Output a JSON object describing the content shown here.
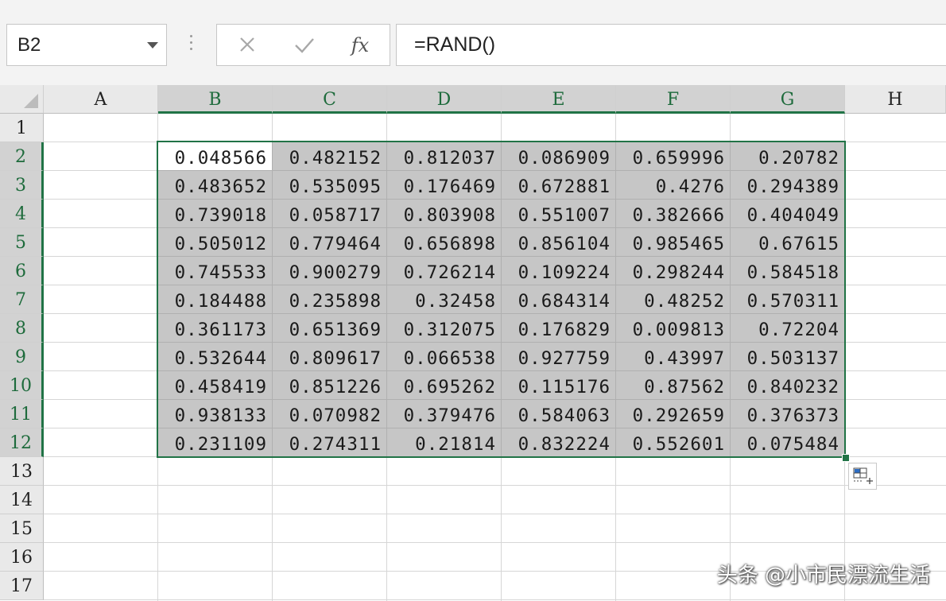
{
  "formula_bar": {
    "name_box": "B2",
    "fx_label": "fx",
    "formula": "=RAND()"
  },
  "columns": [
    "A",
    "B",
    "C",
    "D",
    "E",
    "F",
    "G",
    "H"
  ],
  "rows": [
    "1",
    "2",
    "3",
    "4",
    "5",
    "6",
    "7",
    "8",
    "9",
    "10",
    "11",
    "12",
    "13",
    "14",
    "15",
    "16",
    "17"
  ],
  "selection": {
    "active_cell": "B2",
    "range": "B2:G12",
    "accent_color": "#217346"
  },
  "data_table": [
    [
      "0.048566",
      "0.482152",
      "0.812037",
      "0.086909",
      "0.659996",
      "0.20782"
    ],
    [
      "0.483652",
      "0.535095",
      "0.176469",
      "0.672881",
      "0.4276",
      "0.294389"
    ],
    [
      "0.739018",
      "0.058717",
      "0.803908",
      "0.551007",
      "0.382666",
      "0.404049"
    ],
    [
      "0.505012",
      "0.779464",
      "0.656898",
      "0.856104",
      "0.985465",
      "0.67615"
    ],
    [
      "0.745533",
      "0.900279",
      "0.726214",
      "0.109224",
      "0.298244",
      "0.584518"
    ],
    [
      "0.184488",
      "0.235898",
      "0.32458",
      "0.684314",
      "0.48252",
      "0.570311"
    ],
    [
      "0.361173",
      "0.651369",
      "0.312075",
      "0.176829",
      "0.009813",
      "0.72204"
    ],
    [
      "0.532644",
      "0.809617",
      "0.066538",
      "0.927759",
      "0.43997",
      "0.503137"
    ],
    [
      "0.458419",
      "0.851226",
      "0.695262",
      "0.115176",
      "0.87562",
      "0.840232"
    ],
    [
      "0.938133",
      "0.070982",
      "0.379476",
      "0.584063",
      "0.292659",
      "0.376373"
    ],
    [
      "0.231109",
      "0.274311",
      "0.21814",
      "0.832224",
      "0.552601",
      "0.075484"
    ]
  ],
  "icons": {
    "cancel": "close-icon",
    "enter": "check-icon",
    "function": "fx-icon",
    "quick_analysis": "quick-analysis-icon"
  },
  "watermark": "头条 @小市民漂流生活"
}
